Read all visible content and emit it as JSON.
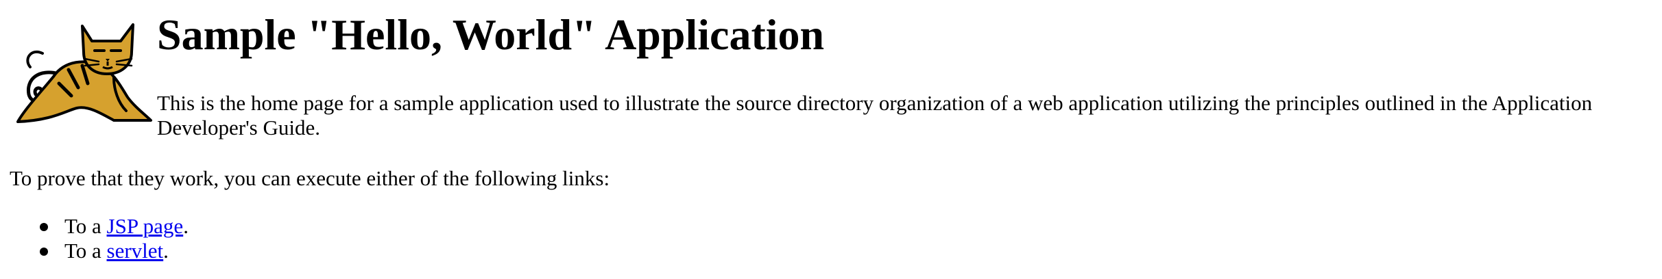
{
  "page": {
    "title": "Sample \"Hello, World\" Application",
    "intro": "This is the home page for a sample application used to illustrate the source directory organization of a web application utilizing the principles outlined in the Application Developer's Guide.",
    "prove_text": "To prove that they work, you can execute either of the following links:"
  },
  "logo": {
    "icon": "tomcat-cat-logo"
  },
  "links": [
    {
      "prefix": "To a ",
      "link_text": "JSP page",
      "suffix": "."
    },
    {
      "prefix": "To a ",
      "link_text": "servlet",
      "suffix": "."
    }
  ],
  "colors": {
    "link": "#0000ee",
    "logo_fill": "#d6a12e",
    "logo_stroke": "#000000"
  }
}
